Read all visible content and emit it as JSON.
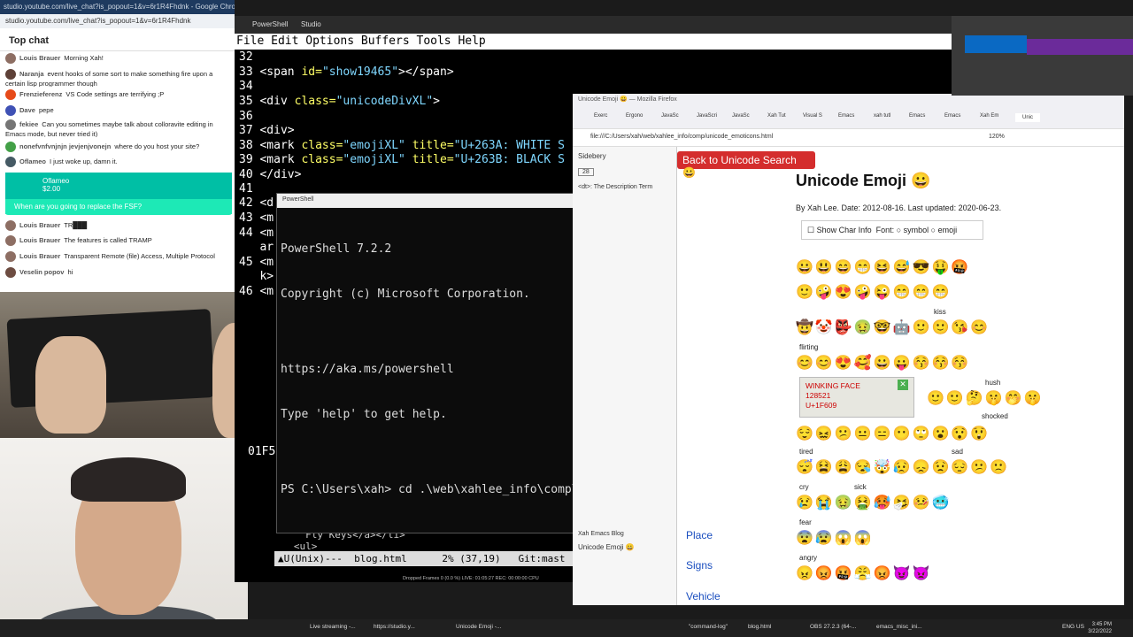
{
  "chat": {
    "tab_title": "studio.youtube.com/live_chat?is_popout=1&v=6r1R4Fhdnk - Google Chrome",
    "url": "studio.youtube.com/live_chat?is_popout=1&v=6r1R4Fhdnk",
    "header": "Top chat",
    "messages": [
      {
        "author": "Louis Brauer",
        "text": "Morning Xah!"
      },
      {
        "author": "Naranja",
        "text": "event hooks of some sort to make something fire upon a certain lisp programmer though"
      },
      {
        "author": "Frenzieferenz",
        "text": "VS Code settings are terrifying ;P"
      },
      {
        "author": "Dave",
        "text": "pepe"
      },
      {
        "author": "fekiee",
        "text": "Can you sometimes maybe talk about colloravite editing in Emacs mode, but never tried it)"
      },
      {
        "author": "nonefvnfvnjnjn jevjenjvonejn",
        "text": "where do you host your site?"
      },
      {
        "author": "Oflameo",
        "text": "I just woke up, damn it."
      }
    ],
    "donation": {
      "author": "Oflameo",
      "amount": "$2.00",
      "text": "When are you going to replace the FSF?"
    },
    "messages2": [
      {
        "author": "Louis Brauer",
        "text": "TR███"
      },
      {
        "author": "Louis Brauer",
        "text": "The features is called TRAMP"
      },
      {
        "author": "Louis Brauer",
        "text": "Transparent Remote (file) Access, Multiple Protocol"
      },
      {
        "author": "Veselin popov",
        "text": "hi"
      }
    ]
  },
  "terminal_window": {
    "tab": "PowerShell",
    "tab2": "Studio"
  },
  "emacs": {
    "menu": "File Edit Options Buffers Tools Help",
    "lines": {
      "l32": "32",
      "l33_num": "33 ",
      "l33a": "<span ",
      "l33b": "id=",
      "l33c": "\"show19465\"",
      "l33d": "></span>",
      "l34": "34",
      "l35_num": "35 ",
      "l35a": "<div ",
      "l35b": "class=",
      "l35c": "\"unicodeDivXL\"",
      "l35d": ">",
      "l36": "36",
      "l37": "37 <div>",
      "l38_num": "38 ",
      "l38a": "<mark ",
      "l38b": "class=",
      "l38c": "\"emojiXL\"",
      "l38d": " title=",
      "l38e": "\"U+263A: WHITE S",
      "l39_num": "39 ",
      "l39a": "<mark ",
      "l39b": "class=",
      "l39c": "\"emojiXL\"",
      "l39d": " title=",
      "l39e": "\"U+263B: BLACK S",
      "l40": "40 </div>",
      "l41": "41",
      "l42": "42 <d",
      "l43": "43 <m",
      "l44": "44 <m",
      "l44b": "   ar",
      "l45": "45 <m",
      "l45b": "   k>",
      "l46": "46 <m",
      "fly": "     Fly Keys</a></li>",
      "ul": "   <ul>",
      "side": "01F5"
    },
    "modeline": "▲U(Unix)---  blog.html      2% (37,19)   Git:mast"
  },
  "powershell": {
    "title": "PowerShell",
    "lines": [
      "PowerShell 7.2.2",
      "Copyright (c) Microsoft Corporation.",
      "",
      "https://aka.ms/powershell",
      "Type 'help' to get help.",
      "",
      "PS C:\\Users\\xah> cd .\\web\\xahlee_info\\comp\\uni"
    ]
  },
  "firefox": {
    "title": "Unicode Emoji 😀 — Mozilla Firefox",
    "tabs": [
      "Exerc",
      "Ergono",
      "JavaSc",
      "JavaScri",
      "JavaSc",
      "Xah Tut",
      "Visual S",
      "Emacs",
      "xah tutl",
      "Emacs",
      "Emacs",
      "Xah Em",
      "Unic"
    ],
    "url": "file:///C:/Users/xah/web/xahlee_info/comp/unicode_emoticons.html",
    "zoom": "120%",
    "sidebar_label": "Sidebery",
    "sidebar_count": "28",
    "sidebar_item": "<dt>: The Description Term",
    "sidebar_bottom": [
      "Xah Emacs Blog",
      "Unicode Emoji 😀"
    ],
    "back_button": "Back to Unicode Search 😀",
    "page_title": "Unicode Emoji 😀",
    "byline": "By Xah Lee. Date: 2012-08-16. Last updated: 2020-06-23.",
    "options": {
      "show_char": "Show Char Info",
      "font": "Font:",
      "symbol": "symbol",
      "emoji": "emoji"
    },
    "rows": [
      "😀😃😄😁😆😅😎🤑🤬",
      "🙂🤪😍🤪😜😁😁😁",
      "🤠🤡👺🤢🤓🤖🙂🙂😘😊",
      "😊😊😍🥰😀😛😚😚😚",
      "🙂🙂🤔🤫🤭🤫",
      "😌😖😕😐😑😶🙄😮😯😲",
      "😴😫😩😪🤯😥😞😟😔😕🙁",
      "😢😭🤢🤮🥵🤧🤒🥶",
      "😨😰😱😱",
      "😠😡🤬😤😡😈👿"
    ],
    "groups": {
      "kiss": "kiss",
      "flirting": "flirting",
      "hush": "hush",
      "shocked": "shocked",
      "tired": "tired",
      "sad": "sad",
      "cry": "cry",
      "sick": "sick",
      "fear": "fear",
      "angry": "angry"
    },
    "tooltip": {
      "name": "WINKING FACE",
      "dec": "128521",
      "hex": "U+1F609"
    },
    "nav": [
      "Place",
      "Signs",
      "Vehicle"
    ]
  },
  "taskbar": {
    "items": [
      "Live streaming -...",
      "https://studio.y...",
      "Unicode Emoji -...",
      "\"command-log\"",
      "blog.html",
      "OBS 27.2.3 (64-...",
      "emacs_misc_ini..."
    ],
    "time": "3:45 PM",
    "date": "3/22/2022",
    "lang": "ENG US"
  },
  "obs_status": "Dropped Frames 0 (0.0 %)   LIVE: 01:05:27   REC: 00:00:00   CPU"
}
